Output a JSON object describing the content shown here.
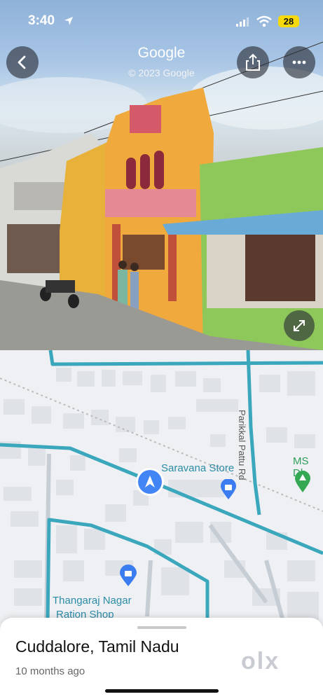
{
  "status": {
    "time": "3:40",
    "battery": "28"
  },
  "header": {
    "title": "Google",
    "copyright": "© 2023 Google"
  },
  "map": {
    "labels": {
      "store": "Saravana Store",
      "road": "Parikkal Pattu Rd",
      "ms": "MS Dh",
      "ration_line1": "Thangaraj Nagar",
      "ration_line2": "Ration Shop"
    }
  },
  "sheet": {
    "place": "Cuddalore, Tamil Nadu",
    "time_ago": "10 months ago",
    "brand": "olx"
  },
  "colors": {
    "route": "#3ba7bd",
    "accent_blue": "#4285f4",
    "green": "#34a853"
  }
}
